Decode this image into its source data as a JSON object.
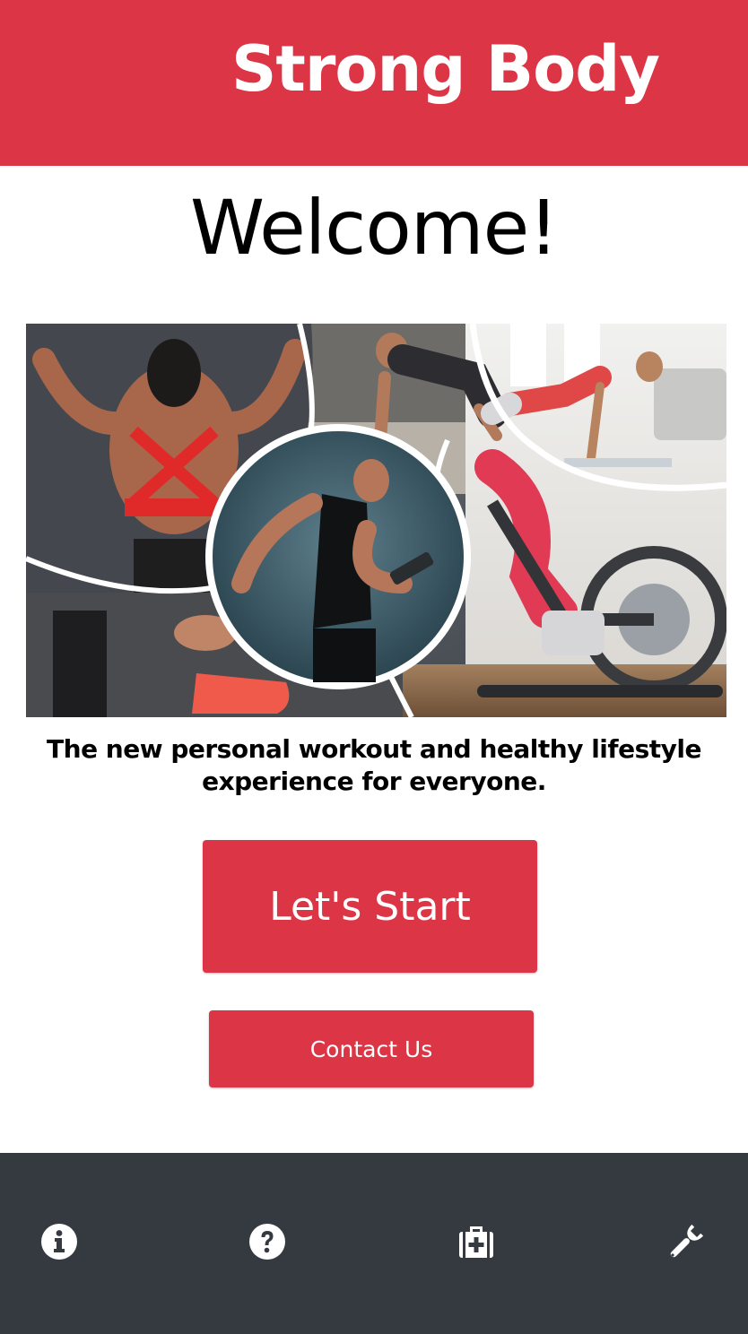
{
  "header": {
    "title": "Strong Body"
  },
  "main": {
    "heading": "Welcome!",
    "tagline_line1": "The new personal workout and healthy lifestyle",
    "tagline_line2": "experience for everyone.",
    "start_label": "Let's Start",
    "contact_label": "Contact Us"
  },
  "bottom_nav": {
    "items": [
      {
        "icon": "info-icon"
      },
      {
        "icon": "help-icon"
      },
      {
        "icon": "medical-kit-icon"
      },
      {
        "icon": "wrench-icon"
      }
    ]
  },
  "colors": {
    "brand": "#dc3545",
    "nav_background": "#343a40",
    "text": "#000000",
    "on_brand": "#ffffff"
  }
}
